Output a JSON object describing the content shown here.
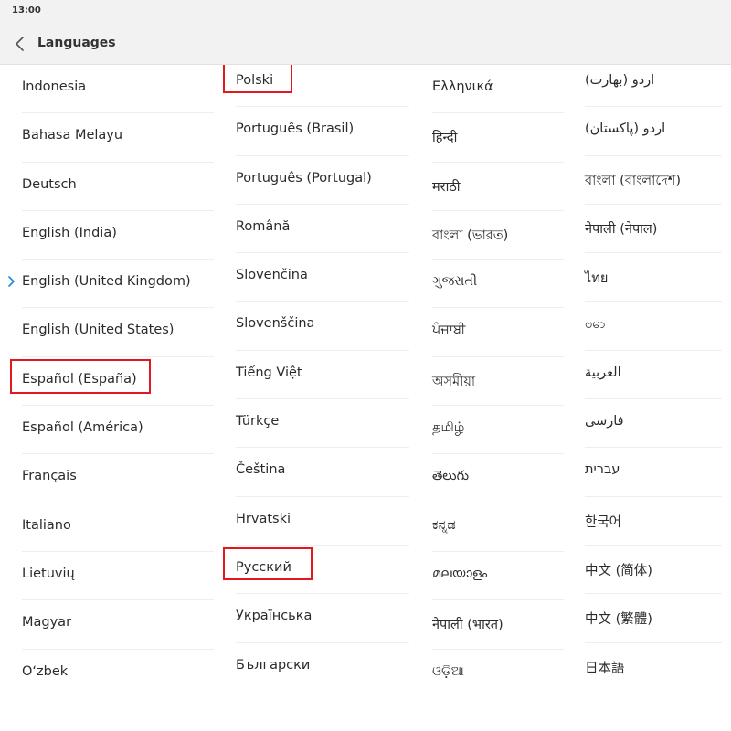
{
  "status_bar": {
    "time": "13:00"
  },
  "toolbar": {
    "title": "Languages",
    "back_icon": "chevron-left-icon"
  },
  "columns": [
    [
      "Indonesia",
      "Bahasa Melayu",
      "Deutsch",
      "English (India)",
      "English (United Kingdom)",
      "English (United States)",
      "Español (España)",
      "Español (América)",
      "Français",
      "Italiano",
      "Lietuvių",
      "Magyar",
      "O‘zbek"
    ],
    [
      "Polski",
      "Português (Brasil)",
      "Português (Portugal)",
      "Română",
      "Slovenčina",
      "Slovenščina",
      "Tiếng Việt",
      "Türkçe",
      "Čeština",
      "Hrvatski",
      "Русский",
      "Українська",
      "Български"
    ],
    [
      "Ελληνικά",
      "हिन्दी",
      "मराठी",
      "বাংলা (ভারত)",
      "ગુજરાતી",
      "ਪੰਜਾਬੀ",
      "অসমীয়া",
      "தமிழ்",
      "తెలుగు",
      "ಕನ್ನಡ",
      "മലയാളം",
      "नेपाली (भारत)",
      "ଓଡ଼ିଆ"
    ],
    [
      "اردو (بھارت)",
      "اردو (پاکستان)",
      "বাংলা (বাংলাদেশ)",
      "नेपाली (नेपाल)",
      "ไทย",
      "ဗမာ",
      "العربية",
      "فارسی",
      "עברית",
      "한국어",
      "中文 (简体)",
      "中文 (繁體)",
      "日本語"
    ]
  ],
  "selected_language": "English (United Kingdom)",
  "selected_icon": "chevron-right-icon",
  "highlighted_items": [
    "Español (España)",
    "Polski",
    "Русский"
  ],
  "colors": {
    "accent": "#1e88e5",
    "highlight_box": "#e0191e",
    "bar_bg": "#f2f2f2"
  }
}
